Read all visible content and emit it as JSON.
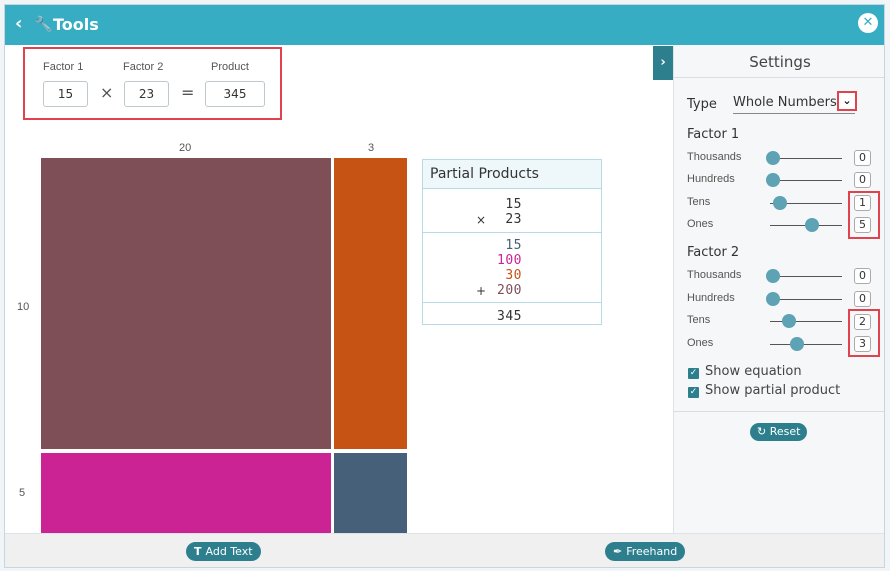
{
  "window": {
    "title": "Tools",
    "back_icon": "chevron-left-icon",
    "tool_icon": "wrench-icon",
    "close_icon": "close-icon",
    "accent": "#36adc3"
  },
  "equation": {
    "factor1_label": "Factor 1",
    "factor2_label": "Factor 2",
    "product_label": "Product",
    "factor1_value": "15",
    "factor2_value": "23",
    "product_value": "345",
    "times_symbol": "×",
    "equals_symbol": "="
  },
  "area_model": {
    "top_labels": [
      "20",
      "3"
    ],
    "side_labels": [
      "10",
      "5"
    ],
    "colors": {
      "tens_tens": "#7f4f57",
      "tens_ones": "#c65214",
      "ones_tens": "#cc2394",
      "ones_ones": "#466079"
    }
  },
  "partial_products": {
    "title": "Partial Products",
    "factor1": "15",
    "factor2": "23",
    "times": "×",
    "items": [
      "15",
      "100",
      "30",
      "200"
    ],
    "plus": "+",
    "total": "345",
    "item_colors": [
      "#466079",
      "#cc2394",
      "#c65214",
      "#7f4f57"
    ]
  },
  "settings": {
    "title": "Settings",
    "type_label": "Type",
    "type_value": "Whole Numbers",
    "factor1_title": "Factor 1",
    "factor2_title": "Factor 2",
    "factor1_rows": [
      {
        "label": "Thousands",
        "value": "0"
      },
      {
        "label": "Hundreds",
        "value": "0"
      },
      {
        "label": "Tens",
        "value": "1"
      },
      {
        "label": "Ones",
        "value": "5"
      }
    ],
    "factor2_rows": [
      {
        "label": "Thousands",
        "value": "0"
      },
      {
        "label": "Hundreds",
        "value": "0"
      },
      {
        "label": "Tens",
        "value": "2"
      },
      {
        "label": "Ones",
        "value": "3"
      }
    ],
    "show_equation": "Show equation",
    "show_partial_product": "Show partial product",
    "reset_label": "Reset"
  },
  "toolbar": {
    "add_text_label": "Add Text",
    "freehand_label": "Freehand"
  }
}
